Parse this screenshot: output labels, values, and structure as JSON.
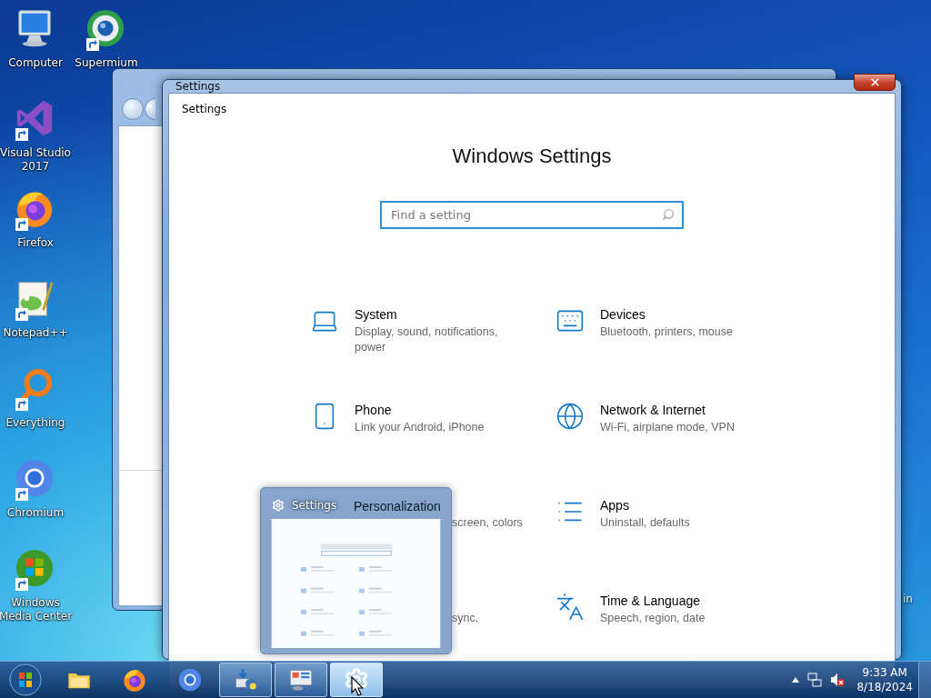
{
  "desktop": {
    "icons": [
      {
        "kind": "computer",
        "label": "Computer",
        "shortcut": false
      },
      {
        "kind": "supermium",
        "label": "Supermium",
        "shortcut": true
      },
      {
        "kind": "visual-studio",
        "label": "Visual Studio 2017",
        "shortcut": true
      },
      {
        "kind": "firefox",
        "label": "Firefox",
        "shortcut": true
      },
      {
        "kind": "notepad",
        "label": "Notepad++",
        "shortcut": true
      },
      {
        "kind": "everything",
        "label": "Everything",
        "shortcut": true
      },
      {
        "kind": "chromium",
        "label": "Chromium",
        "shortcut": true
      },
      {
        "kind": "media-center",
        "label": "Windows Media Center",
        "shortcut": true
      }
    ],
    "cut_label": "in"
  },
  "settings_window": {
    "title": "Settings",
    "app_title": "Settings",
    "heading": "Windows Settings",
    "search": {
      "placeholder": "Find a setting"
    },
    "tiles": [
      {
        "kind": "system",
        "title": "System",
        "description": "Display, sound, notifications, power"
      },
      {
        "kind": "devices",
        "title": "Devices",
        "description": "Bluetooth, printers, mouse"
      },
      {
        "kind": "phone",
        "title": "Phone",
        "description": "Link your Android, iPhone"
      },
      {
        "kind": "network",
        "title": "Network & Internet",
        "description": "Wi-Fi, airplane mode, VPN"
      },
      {
        "kind": "personalization",
        "title": "Personalization",
        "description": "screen, colors"
      },
      {
        "kind": "apps",
        "title": "Apps",
        "description": "Uninstall, defaults"
      },
      {
        "kind": "accounts",
        "description": "sync,"
      },
      {
        "kind": "time",
        "title": "Time & Language",
        "description": "Speech, region, date"
      }
    ]
  },
  "taskbar_preview": {
    "title": "Settings"
  },
  "taskbar": {
    "items": [
      {
        "kind": "explorer",
        "running": false,
        "selected": false
      },
      {
        "kind": "firefox",
        "running": false,
        "selected": false
      },
      {
        "kind": "chromium",
        "running": false,
        "selected": false
      },
      {
        "kind": "installer",
        "running": true,
        "selected": false
      },
      {
        "kind": "control-panel",
        "running": true,
        "selected": false
      },
      {
        "kind": "settings",
        "running": true,
        "selected": true
      }
    ],
    "clock": {
      "time": "9:33 AM",
      "date": "8/18/2024"
    }
  }
}
